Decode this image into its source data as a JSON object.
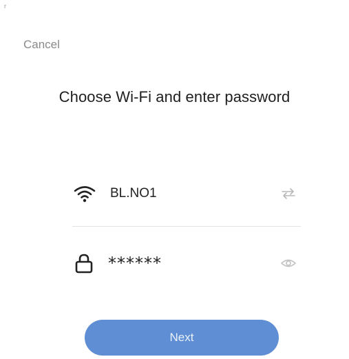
{
  "header": {
    "cancel_label": "Cancel"
  },
  "title": "Choose Wi-Fi and enter password",
  "wifi": {
    "ssid": "BL.NO1",
    "icon": "wifi-icon",
    "action_icon": "switch-network-icon"
  },
  "password": {
    "value": "******",
    "icon": "lock-icon",
    "action_icon": "eye-icon"
  },
  "footer": {
    "next_label": "Next"
  },
  "colors": {
    "accent": "#5f8ed4",
    "muted_text": "#8a8a8a",
    "divider": "#e2e2e2"
  }
}
